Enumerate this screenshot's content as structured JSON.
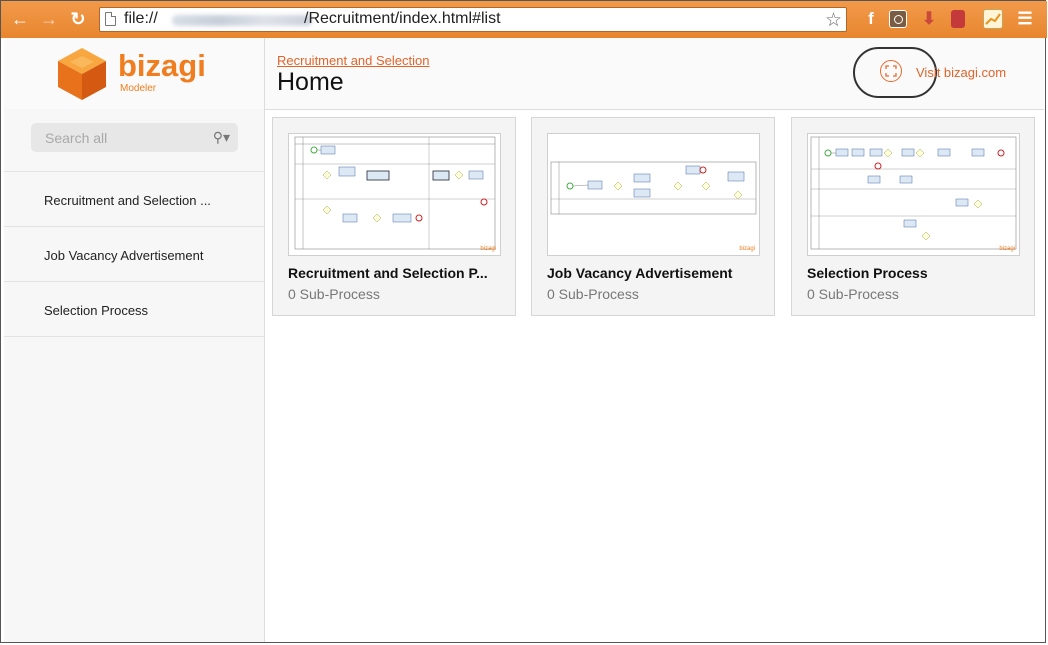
{
  "browser": {
    "url_prefix": "file://",
    "url_suffix": "/Recruitment/index.html#list",
    "colors": {
      "chrome": "#e8862f",
      "accent": "#e0642a"
    }
  },
  "header": {
    "logo_text": "bizagi",
    "logo_sub": "Modeler",
    "breadcrumb": "Recruitment and Selection",
    "title": "Home",
    "visit_link": "Visit bizagi.com"
  },
  "sidebar": {
    "search_placeholder": "Search all",
    "items": [
      {
        "label": "Recruitment and Selection ..."
      },
      {
        "label": "Job Vacancy Advertisement"
      },
      {
        "label": "Selection Process"
      }
    ]
  },
  "cards": [
    {
      "title": "Recruitment and Selection P...",
      "subtitle": "0 Sub-Process"
    },
    {
      "title": "Job Vacancy Advertisement",
      "subtitle": "0 Sub-Process"
    },
    {
      "title": "Selection Process",
      "subtitle": "0 Sub-Process"
    }
  ]
}
